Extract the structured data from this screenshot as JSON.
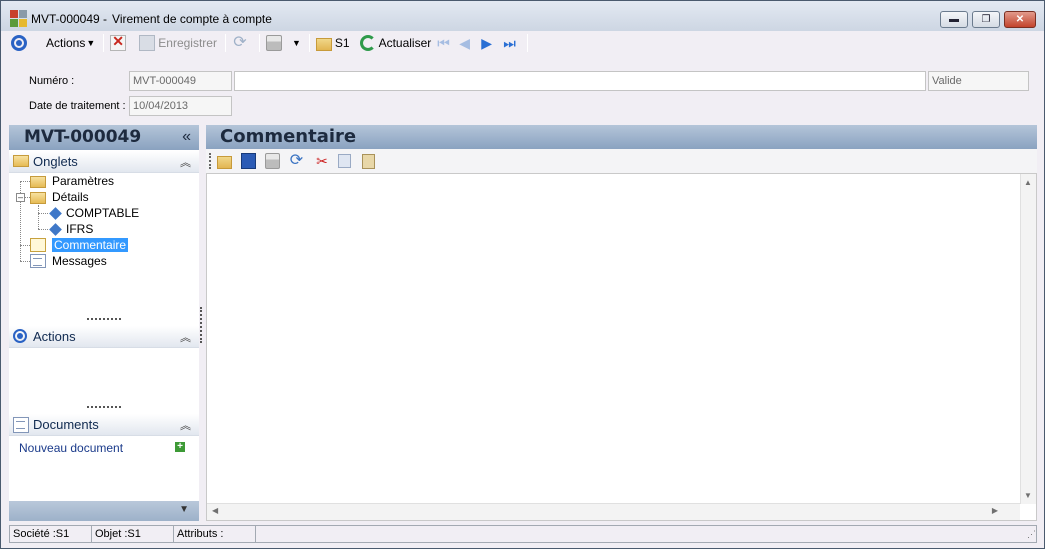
{
  "window": {
    "record_id": "MVT-000049 -",
    "title": "Virement de compte à compte",
    "minimize": "▬",
    "maximize": "❐",
    "close": "✕"
  },
  "toolbar": {
    "actions_label": "Actions",
    "save_label": "Enregistrer",
    "folder_label": "S1",
    "refresh_label": "Actualiser"
  },
  "header": {
    "numero_label": "Numéro :",
    "numero_value": "MVT-000049",
    "description_value": "",
    "status_value": "Valide",
    "date_label": "Date de traitement :",
    "date_value": "10/04/2013"
  },
  "left_panel": {
    "title": "MVT-000049",
    "collapse": "«",
    "onglets": {
      "label": "Onglets",
      "items": [
        {
          "label": "Paramètres"
        },
        {
          "label": "Détails"
        },
        {
          "label": "COMPTABLE"
        },
        {
          "label": "IFRS"
        },
        {
          "label": "Commentaire"
        },
        {
          "label": "Messages"
        }
      ]
    },
    "actions": {
      "label": "Actions"
    },
    "documents": {
      "label": "Documents",
      "new_document": "Nouveau document"
    },
    "chevron_up": "︽",
    "chevron_down": "▼"
  },
  "content": {
    "title": "Commentaire",
    "text": ""
  },
  "statusbar": {
    "societe": "Société :S1",
    "objet": "Objet :S1",
    "attributs": "Attributs :"
  },
  "colors": {
    "accent": "#3399ff",
    "header_gradient": "#8aa2c0",
    "link": "#1a3a8a"
  }
}
